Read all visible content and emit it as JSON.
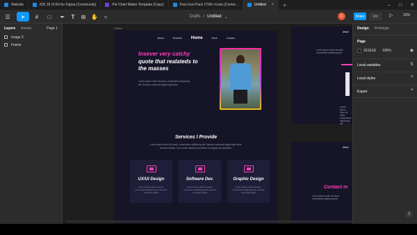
{
  "tabs": [
    {
      "label": "Website",
      "icon": "figma-file-icon"
    },
    {
      "label": "iOS 18 UI Kit for Figma (Community)",
      "icon": "figma-file-icon"
    },
    {
      "label": "Pie Chart Maker Template (Copy)",
      "icon": "figjam-icon"
    },
    {
      "label": "Free Icon Pack 1700+ Icons (Comm...",
      "icon": "figma-file-icon"
    },
    {
      "label": "Untitled",
      "icon": "figma-file-icon"
    }
  ],
  "toolbar": {
    "breadcrumb_folder": "Drafts",
    "breadcrumb_sep": "/",
    "file_name": "Untitled",
    "avatar_initial": "D",
    "share_label": "Share",
    "zoom_label": "33%"
  },
  "left_panel": {
    "tab_layers": "Layers",
    "tab_assets": "Assets",
    "page_selector": "Page 1",
    "layers": [
      "image 2",
      "Frame"
    ]
  },
  "canvas": {
    "frame_label": "Frame",
    "nav": [
      "About",
      "Services",
      "Home",
      "Work",
      "Contact"
    ],
    "hero_highlight": "Insever very catchy",
    "hero_line2": "quote that realateds to",
    "hero_line3": "the masses",
    "hero_paragraph": "Lorem ipsum dolor sit amet, consectetur adipiscing elit. Aenean commodo ligula eget dolor.",
    "services_title": "Services I Provide",
    "services_paragraph": "Lorem ipsum dolor sit amet, consectetur adipiscing elit. Aenean commodo ligula eget dolor. Aenean massa. Cum sociis natoque penatibus et magnis dis parturient.",
    "cards": [
      {
        "title": "UX/UI Design",
        "text": "Lorem ipsum dolor sit amet, consectetur adipiscing elit. Aenean commodo ligula."
      },
      {
        "title": "Software Dev.",
        "text": "Lorem ipsum dolor sit amet, consectetur adipiscing elit. Aenean commodo ligula."
      },
      {
        "title": "Graphic Design",
        "text": "Lorem ipsum dolor sit amet, consectetur adipiscing elit. Aenean commodo ligula."
      }
    ],
    "frame2_nav": "About",
    "frame2_text": "Lorem ipsum dolor sit amet, consectetur adipiscing elit.",
    "frame3_nav": "About",
    "contact_label": "Contact m",
    "frame3_text": "Lorem ipsum dolor sit amet, consectetur adipiscing elit."
  },
  "right_panel": {
    "tab_design": "Design",
    "tab_prototype": "Prototype",
    "page_heading": "Page",
    "page_color_hex": "1E1E1E",
    "page_opacity": "100%",
    "local_variables": "Local variables",
    "local_styles": "Local styles",
    "export": "Export"
  },
  "help_label": "?",
  "colors": {
    "accent": "#0d99ff",
    "brand_pink": "#ff3fb4",
    "frame_bg": "#161528",
    "canvas_bg": "#1e1e1e"
  }
}
